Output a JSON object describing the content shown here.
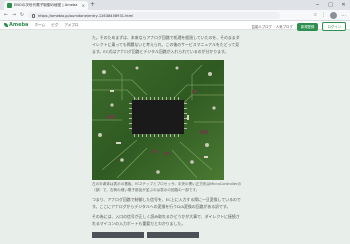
{
  "browser": {
    "tab_title": "ENGの次世代電子制御の秘密 | Ameba",
    "url": "https://ameblo.jp/oumitone/entry-12638458931.html",
    "nav": {
      "back": "←",
      "forward": "→",
      "refresh": "↻"
    },
    "new_tab": "+",
    "window": {
      "minimize": "─",
      "maximize": "□",
      "close": "✕"
    },
    "toolbar_icons": {
      "favorite": "☆",
      "collections": "⋮",
      "more": "…"
    }
  },
  "header": {
    "logo": "Ameba",
    "nav": [
      "ホーム",
      "ピグ",
      "アメブロ"
    ],
    "links": [
      "芸能人ブログ",
      "人気ブログ"
    ],
    "signup": "新規登録",
    "login": "ログイン"
  },
  "article": {
    "p1": "た。そのためまずは、本来ならアナログ回路で処理を経過していたのを、そのままダイレクトに乗っても問題ないと考えられ、この後のサービスマニュアルをたどって見ます。EC式はアナログ回路とデジタル回路が入れられているのが分かります。",
    "caption": "左の半導体は表示の基板、EC2チップとプロセッサ。中央の黒い正方形はMicroControllerの（部）で、右側の細い電子部品が並ぶのは表示の回路の一部です。",
    "p2": "つまり、アナログ回路で制御した信号を、EC上に入力する際に一旦変換しているのです。ここにアナログからデジタルへの変換を行うD/A変換の回路がある訳です。",
    "p3": "その為には、入口の信号が正しく読み取れるかどうかが大事で、ダイレクトに接続されるマイコンの入力ポートも重要だとわかりました。"
  },
  "colors": {
    "accent": "#2d8f4e",
    "page_bg": "#e8eee9",
    "text": "#555555"
  }
}
